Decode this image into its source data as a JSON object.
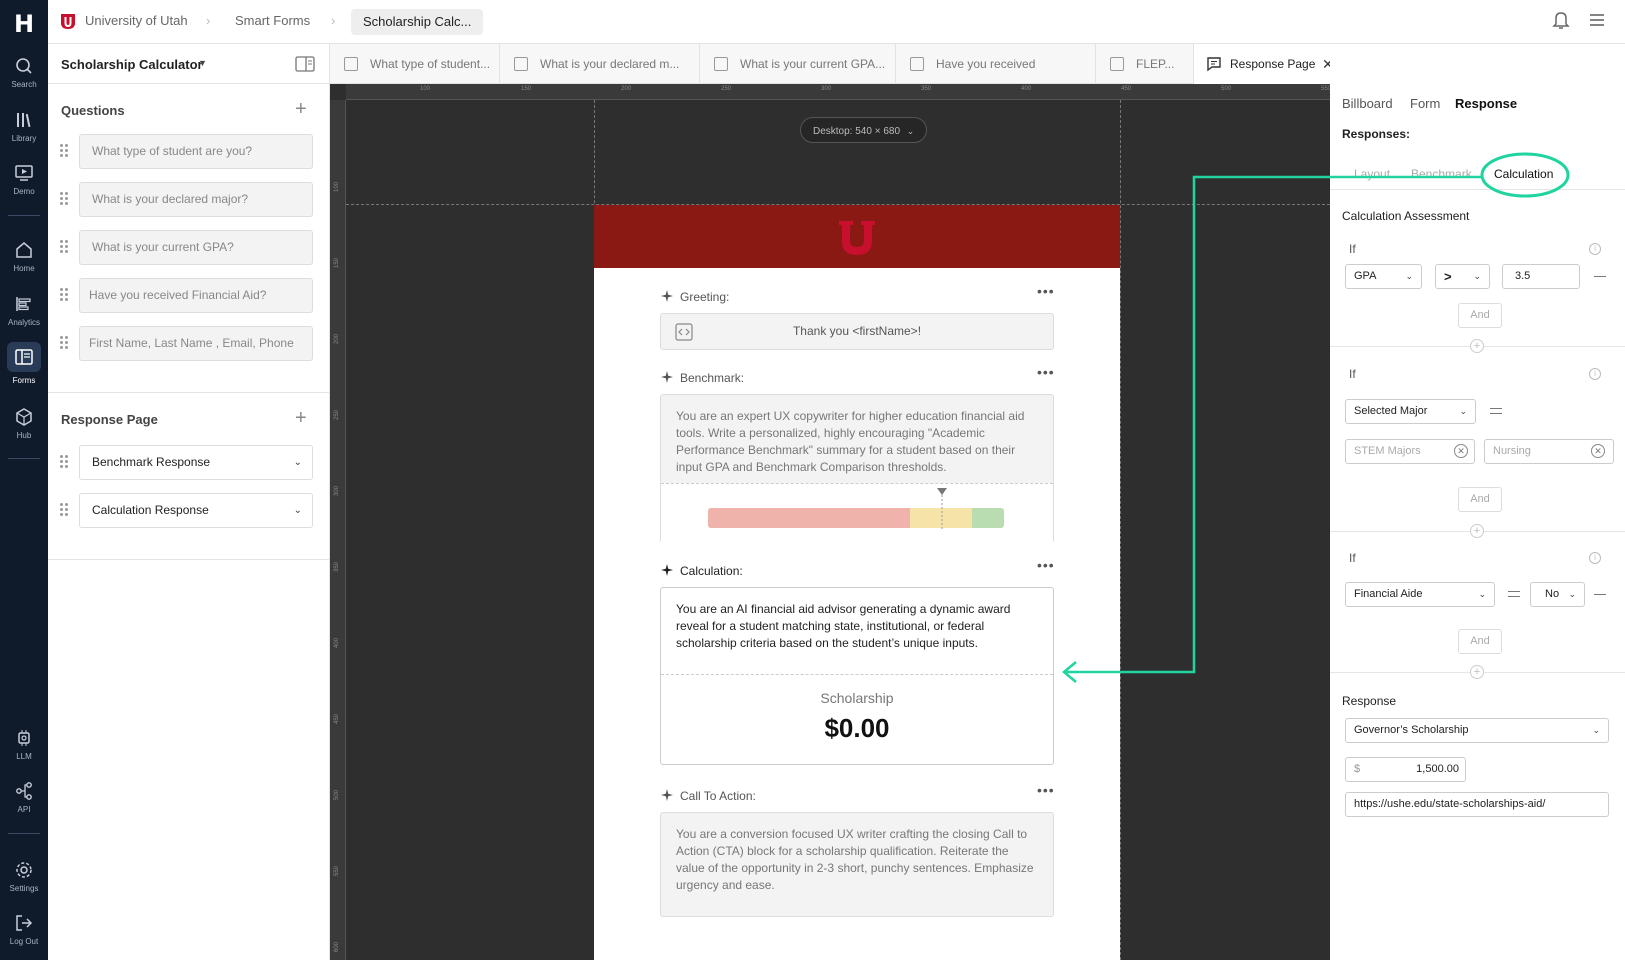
{
  "topbar": {
    "breadcrumb": [
      "University of Utah",
      "Smart Forms",
      "Scholarship Calc..."
    ]
  },
  "rail": {
    "items": [
      "Search",
      "Library",
      "Demo",
      "Home",
      "Analytics",
      "Forms",
      "Hub",
      "LLM",
      "API",
      "Settings",
      "Log Out"
    ],
    "active": "Forms"
  },
  "left_panel": {
    "form_name": "Scholarship Calculator",
    "questions_title": "Questions",
    "questions": [
      "What type of student are you?",
      "What is your declared major?",
      "What is your current GPA?",
      "Have you received Financial Aid?",
      "First Name, Last Name , Email, Phone"
    ],
    "response_title": "Response Page",
    "responses": [
      "Benchmark Response",
      "Calculation Response"
    ]
  },
  "tabs": [
    "What type of student...",
    "What is your declared m...",
    "What is your current GPA...",
    "Have you received Financial...",
    "FLEP...",
    "Response Page"
  ],
  "canvas": {
    "device_label": "Desktop: 540 × 680",
    "ruler_top": [
      "100",
      "150",
      "200",
      "250",
      "300",
      "350",
      "400",
      "450",
      "500",
      "550"
    ],
    "ruler_left": [
      "100",
      "150",
      "200",
      "250",
      "300",
      "350",
      "400",
      "450",
      "500",
      "550",
      "600"
    ]
  },
  "phone": {
    "greeting_title": "Greeting:",
    "greeting_text": "Thank you <firstName>!",
    "benchmark_title": "Benchmark:",
    "benchmark_text": "You are an expert UX copywriter for higher education financial aid tools. Write a personalized, highly encouraging \"Academic Performance Benchmark\" summary for a student based on their input GPA and Benchmark Comparison thresholds.",
    "calculation_title": "Calculation:",
    "calculation_text": "You are an AI financial aid advisor generating a dynamic award reveal for a student matching state, institutional, or federal scholarship criteria based on the student’s unique inputs.",
    "scholarship_label": "Scholarship",
    "scholarship_amount": "$0.00",
    "cta_title": "Call To Action:",
    "cta_text": "You are a conversion focused UX writer crafting the closing Call to Action (CTA) block for a scholarship qualification. Reiterate the value of the opportunity in 2-3 short, punchy sentences. Emphasize urgency and ease."
  },
  "right_panel": {
    "tabs": [
      "Billboard",
      "Form",
      "Response"
    ],
    "responses_label": "Responses:",
    "subtabs": [
      "Layout",
      "Benchmark",
      "Calculation"
    ],
    "assessment_title": "Calculation Assessment",
    "if_label": "If",
    "and_label": "And",
    "cond1": {
      "field": "GPA",
      "operator": ">",
      "value": "3.5"
    },
    "cond2": {
      "field": "Selected Major",
      "chips": [
        "STEM Majors",
        "Nursing"
      ]
    },
    "cond3": {
      "field": "Financial Aide",
      "value": "No"
    },
    "response_label": "Response",
    "response_select": "Governor’s Scholarship",
    "currency": "$",
    "amount": "1,500.00",
    "url": "https://ushe.edu/state-scholarships-aid/"
  },
  "colors": {
    "accent": "#20d4a0",
    "brand": "#8b1913",
    "rail": "#0f1a2b"
  }
}
